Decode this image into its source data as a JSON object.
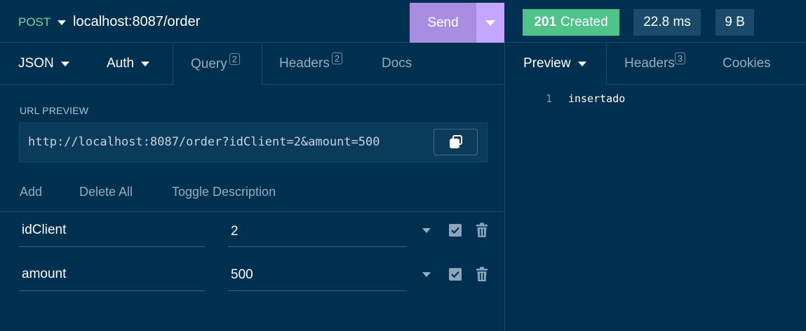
{
  "request": {
    "method": "POST",
    "url": "localhost:8087/order",
    "send_label": "Send"
  },
  "response": {
    "status_code": "201",
    "status_text": "Created",
    "time": "22.8 ms",
    "size": "9 B"
  },
  "left_tabs": {
    "body": "JSON",
    "auth": "Auth",
    "query": "Query",
    "query_count": "2",
    "headers": "Headers",
    "headers_count": "2",
    "docs": "Docs"
  },
  "url_preview": {
    "label": "URL PREVIEW",
    "value": "http://localhost:8087/order?idClient=2&amount=500"
  },
  "actions": {
    "add": "Add",
    "delete_all": "Delete All",
    "toggle_description": "Toggle Description"
  },
  "params": [
    {
      "name": "idClient",
      "value": "2"
    },
    {
      "name": "amount",
      "value": "500"
    }
  ],
  "right_tabs": {
    "preview": "Preview",
    "headers": "Headers",
    "headers_count": "3",
    "cookies": "Cookies"
  },
  "preview": {
    "line_number": "1",
    "line_text": "insertado"
  },
  "colors": {
    "background": "#00304f",
    "method": "#6ad7a3",
    "send": "#a88ee0",
    "status_ok": "#4fc38a"
  }
}
